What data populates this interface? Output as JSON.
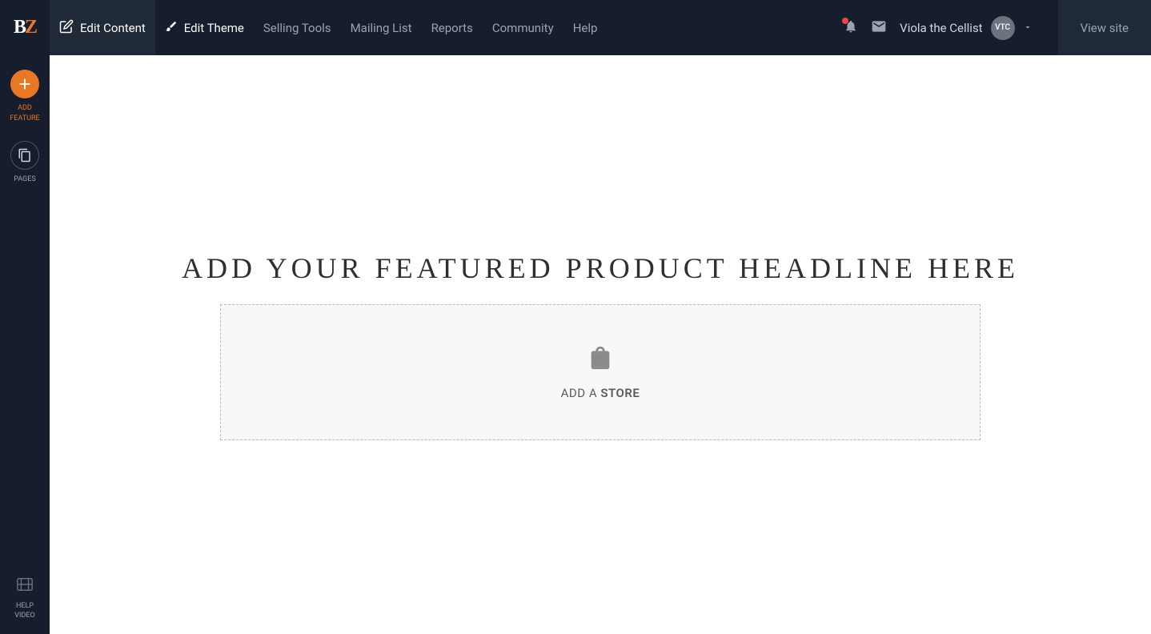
{
  "logo": {
    "letter1": "B",
    "letter2": "Z"
  },
  "nav": {
    "items": [
      {
        "label": "Edit Content",
        "icon": "edit-icon"
      },
      {
        "label": "Edit Theme",
        "icon": "brush-icon"
      },
      {
        "label": "Selling Tools"
      },
      {
        "label": "Mailing List"
      },
      {
        "label": "Reports"
      },
      {
        "label": "Community"
      },
      {
        "label": "Help"
      }
    ]
  },
  "user": {
    "name": "Viola the Cellist",
    "initials": "VTC"
  },
  "view_site_label": "View site",
  "sidebar": {
    "add_label_line1": "ADD",
    "add_label_line2": "FEATURE",
    "pages_label": "PAGES",
    "help_line1": "HELP",
    "help_line2": "VIDEO"
  },
  "canvas": {
    "headline": "ADD YOUR FEATURED PRODUCT HEADLINE HERE",
    "add_store_prefix": "ADD A ",
    "add_store_bold": "STORE"
  }
}
